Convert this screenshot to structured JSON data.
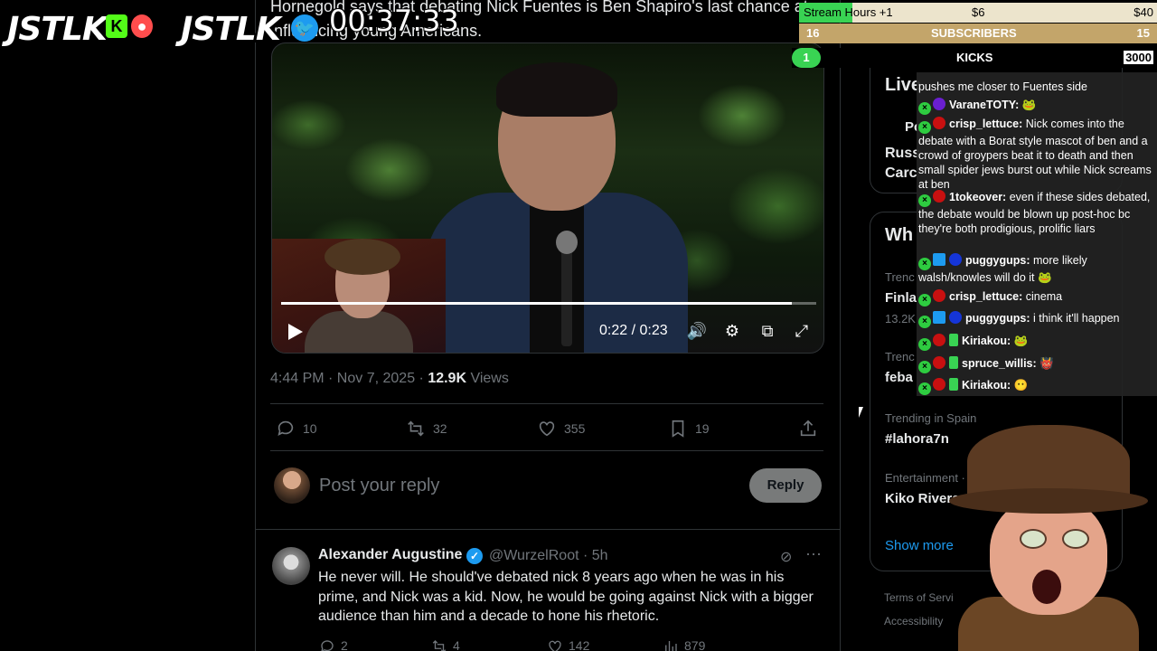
{
  "post": {
    "text": "Hornegold says that debating Nick Fuentes is Ben Shapiro's last chance at influencing young Americans.",
    "video": {
      "time": "0:22 / 0:23",
      "progress": 0.955
    },
    "timestamp": "4:44 PM · Nov 7, 2025 · ",
    "views_count": "12.9K",
    "views_label": " Views",
    "actions": {
      "replies": "10",
      "reposts": "32",
      "likes": "355",
      "bookmarks": "19"
    },
    "reply_box": {
      "placeholder": "Post your reply",
      "button": "Reply"
    }
  },
  "comment": {
    "name": "Alexander Augustine",
    "handle": "@WurzelRoot · 5h",
    "text": "He never will. He should've debated nick 8 years ago when he was in his prime, and Nick was a kid. Now, he would be going against Nick with a bigger audience than him and a decade to hone his rhetoric.",
    "replies": "2",
    "reposts": "4",
    "likes": "142",
    "views": "879"
  },
  "sidebar": {
    "live_title": "Live",
    "live_sub": "Pc",
    "live_item1": "Russ",
    "live_item2": "Carc",
    "whats_happening": "Wh",
    "trend1_label": "Trenc",
    "trend1_name": "Finla",
    "trend1_count": "13.2K",
    "trend2_label": "Trenc",
    "trend2_name": "feba",
    "trend3_label": "Trending in Spain",
    "trend3_name": "#lahora7n",
    "trend4_label": "Entertainment · Tren",
    "trend4_name": "Kiko Rivera",
    "show_more": "Show more",
    "footer1": "Terms of Servi",
    "footer2": "Accessibility"
  },
  "overlay": {
    "logo1": "JSTLK",
    "logo2": "JSTLK",
    "timer": "00:37:33",
    "bars": {
      "hours_label": "Stream Hours +1",
      "hours_mid": "$6",
      "hours_goal": "$40",
      "subs_left": "16",
      "subs_label": "SUBSCRIBERS",
      "subs_right": "15",
      "kicks_left": "1",
      "kicks_label": "KICKS",
      "kicks_right": "3000"
    },
    "chat": [
      {
        "user": "",
        "text": "pushes me closer to Fuentes side"
      },
      {
        "user": "VaraneTOTY:",
        "text": ""
      },
      {
        "user": "crisp_lettuce:",
        "text": "Nick comes into the debate with a Borat style mascot of ben and a crowd of groypers beat it to death and then small spider jews burst out while Nick screams at ben"
      },
      {
        "user": "1tokeover:",
        "text": "even if these sides debated, the debate would be blown up post-hoc bc they're both prodigious, prolific liars"
      },
      {
        "user": "puggygups:",
        "text": "more likely walsh/knowles will do it"
      },
      {
        "user": "crisp_lettuce:",
        "text": "cinema"
      },
      {
        "user": "puggygups:",
        "text": "i think it'll happen"
      },
      {
        "user": "Kiriakou:",
        "text": ""
      },
      {
        "user": "spruce_willis:",
        "text": ""
      },
      {
        "user": "Kiriakou:",
        "text": ""
      }
    ],
    "colors": {
      "accent_blue": "#1d9bf0",
      "kick_green": "#39d353",
      "subs_gold": "#c3a56a"
    }
  }
}
